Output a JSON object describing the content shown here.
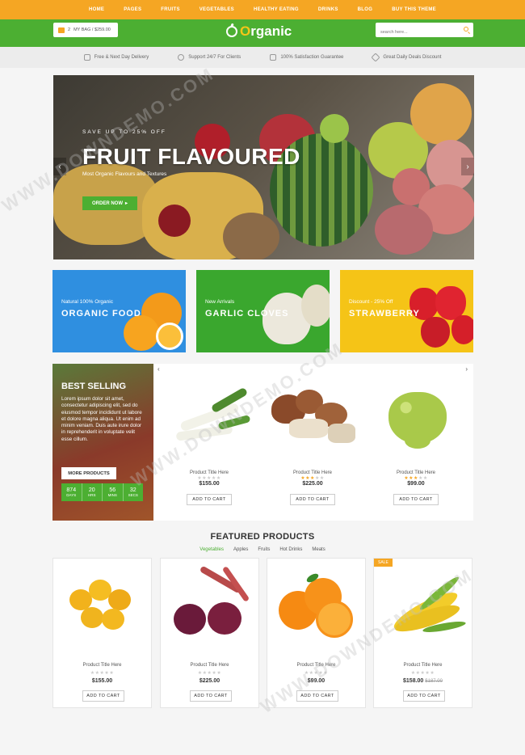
{
  "topnav": {
    "items": [
      "HOME",
      "PAGES",
      "FRUITS",
      "VEGETABLES",
      "HEALTHY EATING",
      "DRINKS",
      "BLOG",
      "BUY THIS THEME"
    ]
  },
  "header": {
    "cart": {
      "count": "2",
      "text": "MY BAG / $259.00"
    },
    "logo": {
      "text": "rganic",
      "letter": "O"
    },
    "search": {
      "placeholder": "search here..."
    }
  },
  "services": [
    {
      "icon": "truck-icon",
      "label": "Free & Next Day Delivery"
    },
    {
      "icon": "headset-icon",
      "label": "Support 24/7 For Clients"
    },
    {
      "icon": "thumbs-up-icon",
      "label": "100% Satisfaction Guarantee"
    },
    {
      "icon": "tag-icon",
      "label": "Great Daily Deals Discount"
    }
  ],
  "hero": {
    "subtitle": "SAVE UP TO 25% OFF",
    "title": "FRUIT FLAVOURED",
    "description": "Most Organic Flavours and Textures",
    "button": "ORDER NOW"
  },
  "banners": [
    {
      "subtitle": "Natural 100% Organic",
      "title": "ORGANIC FOOD",
      "color": "#2f8fe0"
    },
    {
      "subtitle": "New Arrivals",
      "title": "GARLIC CLOVES",
      "color": "#3aa72e"
    },
    {
      "subtitle": "Discount - 25% Off",
      "title": "STRAWBERRY",
      "color": "#f5c417"
    }
  ],
  "bestselling": {
    "title": "BEST SELLING",
    "text": "Lorem ipsum dolor sit amet, consectetur adipiscing elit, sed do eiusmod tempor incididunt ut labore et dolore magna aliqua. Ut enim ad minim veniam. Duis aute irure dolor in reprehenderit in voluptate velit esse cillum.",
    "button": "MORE PRODUCTS",
    "countdown": [
      {
        "value": "874",
        "label": "DAYS"
      },
      {
        "value": "20",
        "label": "HRS"
      },
      {
        "value": "56",
        "label": "MINS"
      },
      {
        "value": "32",
        "label": "SECS"
      }
    ],
    "products": [
      {
        "title": "Product Title Here",
        "rating": 0,
        "price": "$155.00",
        "button": "ADD TO CART"
      },
      {
        "title": "Product Title Here",
        "rating": 3,
        "price": "$225.00",
        "button": "ADD TO CART"
      },
      {
        "title": "Product Title Here",
        "rating": 3,
        "price": "$99.00",
        "button": "ADD TO CART"
      }
    ]
  },
  "featured": {
    "title": "FEATURED PRODUCTS",
    "tabs": [
      "Vegetables",
      "Apples",
      "Fruits",
      "Hot Drinks",
      "Meats"
    ],
    "active_tab": "Vegetables",
    "products": [
      {
        "title": "Product Title Here",
        "rating": 0,
        "price": "$155.00",
        "old_price": "",
        "button": "ADD TO CART",
        "badge": ""
      },
      {
        "title": "Product Title Here",
        "rating": 0,
        "price": "$225.00",
        "old_price": "",
        "button": "ADD TO CART",
        "badge": ""
      },
      {
        "title": "Product Title Here",
        "rating": 0,
        "price": "$99.00",
        "old_price": "",
        "button": "ADD TO CART",
        "badge": ""
      },
      {
        "title": "Product Title Here",
        "rating": 0,
        "price": "$158.00",
        "old_price": "$187.00",
        "button": "ADD TO CART",
        "badge": "SALE"
      }
    ]
  },
  "watermark": "WWW.DOWNDEMO.COM"
}
